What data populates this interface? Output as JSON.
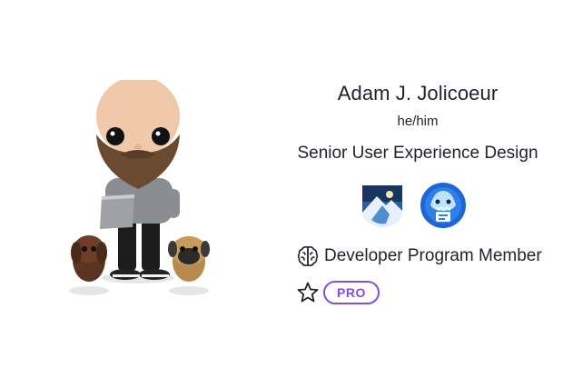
{
  "profile": {
    "name": "Adam J. Jolicoeur",
    "pronouns": "he/him",
    "role": "Senior User Experience Design"
  },
  "badges": [
    {
      "icon": "mountain-badge-icon"
    },
    {
      "icon": "shark-badge-icon"
    }
  ],
  "membership": {
    "label": "Developer Program Member",
    "icon": "brain-icon"
  },
  "plan": {
    "label": "PRO",
    "icon": "star-icon",
    "color": "#8250df"
  }
}
